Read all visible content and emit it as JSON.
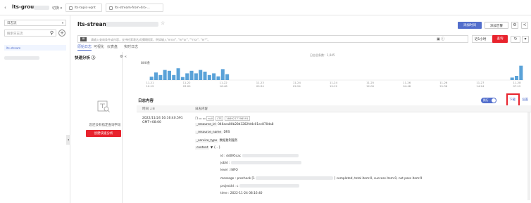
{
  "top": {
    "group_title": "lts-group",
    "switch_label": "切换 ▾",
    "tabs": [
      "lts-topic-vqnt",
      "lts-stream-from-dro-..."
    ]
  },
  "sidebar": {
    "select_value": "日志流",
    "search_placeholder": "搜索日志流",
    "item_label": "lts-stream"
  },
  "header": {
    "stream_title": "lts-stream",
    "star": "☆",
    "btn_realtime": "添加时间",
    "btn_alarm": "添加告警",
    "query_placeholder": "请输入查询条件或内容，支持检索表达式模糊搜索，例如输入\"error\", \"er*or\", \"*rror\", \"er*\"。",
    "time_value": "近1小时",
    "query_btn": "查询"
  },
  "subtabs": [
    "原始日志",
    "可视化",
    "仪表盘",
    "实时日志"
  ],
  "quick": {
    "title": "快速分析 ⓘ",
    "empty_text": "您还没有指定查询字段",
    "create_btn": "创建快速分析",
    "collapse": "◂"
  },
  "chart_data": {
    "type": "bar",
    "title": "日志总条数：1,945",
    "ylabel": "800条",
    "categories": [
      "11-21 10:19",
      "11-22 03:00",
      "11-22 16:48",
      "11-23 09:34",
      "11-24 02:24",
      "11-24 19:12",
      "11-25 12:00",
      "11-26 04:48",
      "11-26 21:36",
      "11-27 14:24",
      "11-28 07:12"
    ],
    "values": [
      20,
      45,
      30,
      60,
      55,
      30,
      70,
      18,
      40,
      55,
      40,
      60,
      50,
      30,
      40,
      22,
      65,
      35,
      0,
      0,
      0,
      0,
      0,
      0,
      0,
      0,
      0,
      0,
      0,
      0,
      0,
      0,
      0,
      0,
      0,
      0,
      0,
      0,
      0,
      0,
      0,
      0,
      0,
      0,
      0,
      0,
      0,
      0,
      0,
      0,
      0,
      0,
      0,
      0,
      0,
      0,
      0,
      0,
      0,
      0,
      0,
      0,
      0,
      0,
      0,
      0,
      0,
      0,
      0,
      0,
      0,
      0,
      0,
      0,
      0,
      0,
      0,
      0,
      0,
      0,
      0,
      15,
      25,
      85
    ],
    "ylim": [
      0,
      100
    ]
  },
  "logs": {
    "title": "日志内容",
    "toggle_label": "换行",
    "download": "下载",
    "settings": "设置",
    "col_time": "时间 ↓≡",
    "col_content": "日志内容",
    "time1": "2022/11/24 16:16:40.591",
    "time2": "GMT+08:00",
    "tags": [
      "null",
      "LTS",
      "1669277798591"
    ],
    "fields": [
      {
        "key": "_resource_id",
        "val": "046aca80b28d3282fd4c01ec870da8"
      },
      {
        "key": "_resource_name",
        "val": "DRS"
      },
      {
        "key": "_service_type",
        "val": "数据复制服务"
      },
      {
        "key": "content",
        "val": "▼ {...}"
      },
      {
        "key": "id",
        "val": ": dd095cac"
      },
      {
        "key": "jobId",
        "val": ":"
      },
      {
        "key": "level",
        "val": ": INFO"
      },
      {
        "key": "message",
        "val": ": precheck [1",
        "val2": "] completed, total item:0, success item:0, not pass item:9"
      },
      {
        "key": "projectId",
        "val": ": c"
      },
      {
        "key": "time",
        "val": ": 2022-11-24 08:16:40"
      }
    ]
  }
}
